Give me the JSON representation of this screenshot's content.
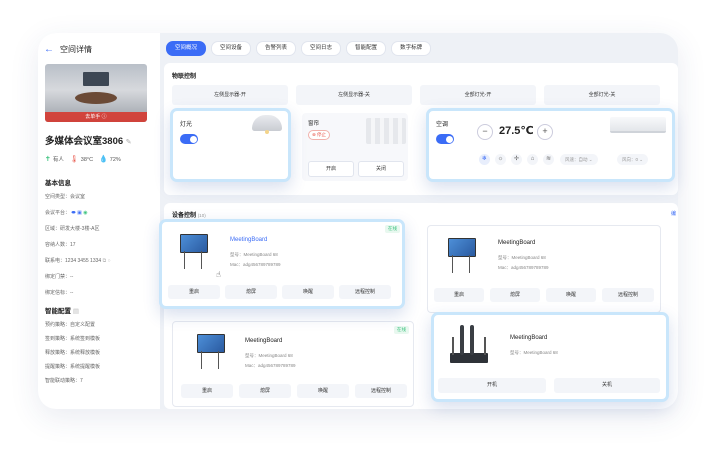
{
  "header": {
    "back_icon": "←",
    "title": "空间详情"
  },
  "tabs": [
    {
      "label": "空间概况",
      "active": true
    },
    {
      "label": "空间设备"
    },
    {
      "label": "告警列表"
    },
    {
      "label": "空间日志"
    },
    {
      "label": "智能配置"
    },
    {
      "label": "数字标牌"
    }
  ],
  "room": {
    "image_badge": "去单手 ⓘ",
    "name": "多媒体会议室3806",
    "edit_icon": "✎",
    "stats": [
      {
        "icon": "person-icon",
        "text": "有人"
      },
      {
        "icon": "thermometer-icon",
        "text": "38°C"
      },
      {
        "icon": "droplet-icon",
        "text": "72%"
      }
    ]
  },
  "basic": {
    "title": "基本信息",
    "rows": [
      {
        "label": "空间类型：",
        "value": "会议室"
      },
      {
        "label": "会议平台：",
        "value": ""
      },
      {
        "label": "区域：",
        "value": "研发大楼-3楼-A区"
      },
      {
        "label": "容纳人数：",
        "value": "17"
      },
      {
        "label": "联系电：",
        "value": "1234 3455 1334"
      },
      {
        "label": "绑定门禁：",
        "value": "--"
      },
      {
        "label": "绑定信标：",
        "value": "--"
      }
    ]
  },
  "smart": {
    "title": "智能配置",
    "rows": [
      {
        "label": "预约策略：",
        "value": "自定义配置"
      },
      {
        "label": "签到策略：",
        "value": "系统签到模板"
      },
      {
        "label": "释放策略：",
        "value": "系统释放模板"
      },
      {
        "label": "提醒策略：",
        "value": "系统提醒模板"
      },
      {
        "label": "智能联动策略：",
        "value": "7"
      }
    ]
  },
  "linkage": {
    "title": "物联控制",
    "scenes": [
      "左侧显示器-开",
      "左侧显示器-关",
      "全部灯光-开",
      "全部灯光-关"
    ]
  },
  "light": {
    "label": "灯光"
  },
  "curtain": {
    "label": "窗帘",
    "status": "停止",
    "open": "开启",
    "close": "关闭"
  },
  "ac": {
    "label": "空调",
    "minus": "−",
    "temp": "27.5℃",
    "plus": "+",
    "fan_speed": "风速：自动",
    "fan_dir": "风向：0"
  },
  "devices": {
    "title": "设备控制",
    "count": "(10)",
    "more": "编",
    "boards": [
      {
        "name": "MeetingBoard",
        "model": "型号：MeetingBoard 68",
        "mac": "Mac：adg456789789789",
        "status": "在线",
        "actions": [
          "重启",
          "熄屏",
          "唤醒",
          "远程控制"
        ]
      },
      {
        "name": "MeetingBoard",
        "model": "型号：MeetingBoard 68",
        "mac": "Mac：adg456789789789",
        "status": "",
        "actions": [
          "重启",
          "熄屏",
          "唤醒",
          "远程控制"
        ]
      },
      {
        "name": "MeetingBoard",
        "model": "型号：MeetingBoard 68",
        "mac": "Mac：adg456789789789",
        "status": "在线",
        "actions": [
          "重启",
          "熄屏",
          "唤醒",
          "远程控制"
        ]
      }
    ],
    "mic": {
      "name": "MeetingBoard",
      "model": "型号：MeetingBoard 68",
      "on": "开机",
      "off": "关机"
    }
  }
}
